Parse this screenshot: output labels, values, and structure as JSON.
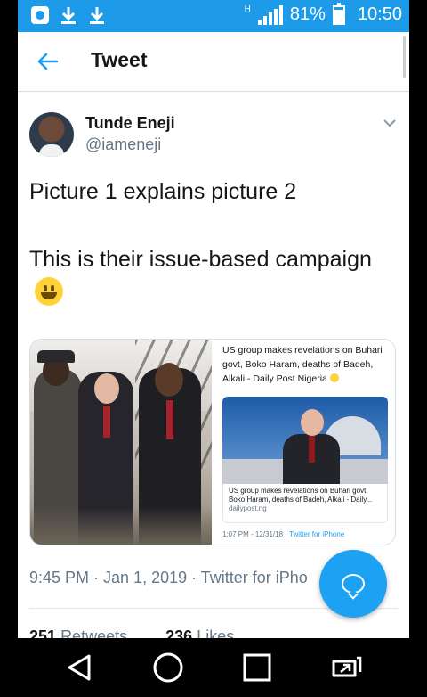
{
  "status_bar": {
    "notification_icons": [
      "app-notification-icon",
      "download-icon",
      "download-icon"
    ],
    "network_label": "H",
    "battery_percent": "81%",
    "battery_level": 0.81,
    "time": "10:50"
  },
  "app_bar": {
    "back_icon": "back-arrow-icon",
    "title": "Tweet"
  },
  "tweet": {
    "author_name": "Tunde Eneji",
    "author_handle": "@iameneji",
    "menu_icon": "chevron-down-icon",
    "text_line1": "Picture 1 explains picture 2",
    "text_line2": "This is their issue-based campaign",
    "emoji": "smiling-face-emoji",
    "media": {
      "photo2_headline": "US group makes revelations on Buhari govt, Boko Haram, deaths of Badeh, Alkali - Daily Post Nigeria",
      "photo2_card_title": "US group makes revelations on Buhari govt, Boko Haram, deaths of Badeh, Alkali - Daily...",
      "photo2_card_domain": "dailypost.ng",
      "photo2_meta_time": "1:07 PM - 12/31/18 ·",
      "photo2_meta_source": "Twitter for iPhone"
    },
    "timestamp": "9:45 PM · Jan 1, 2019 · Twitter for iPho",
    "retweets_count": "251",
    "retweets_label": "Retweets",
    "likes_count": "236",
    "likes_label": "Likes"
  },
  "fab": {
    "icon": "reply-bubble-icon"
  },
  "nav_bar": {
    "buttons": [
      "back-triangle-icon",
      "home-circle-icon",
      "recents-square-icon",
      "screen-mirror-icon"
    ]
  },
  "colors": {
    "accent": "#1da1f2",
    "status_bar": "#1e9be8",
    "text_primary": "#14171a",
    "text_secondary": "#657786"
  }
}
